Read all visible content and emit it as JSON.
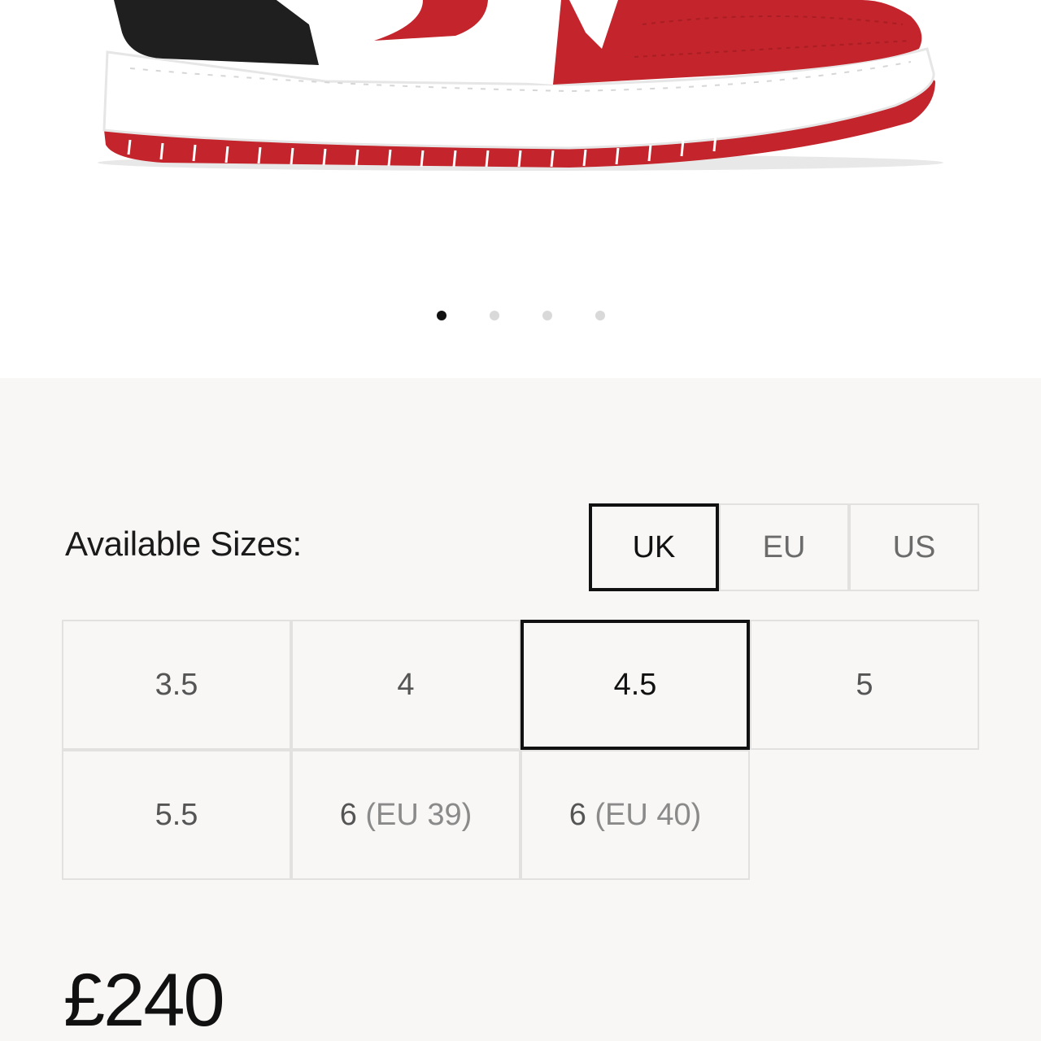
{
  "carousel": {
    "slide_count": 4,
    "active_index": 0
  },
  "sizes": {
    "label": "Available Sizes:",
    "units": [
      {
        "label": "UK",
        "selected": true
      },
      {
        "label": "EU",
        "selected": false
      },
      {
        "label": "US",
        "selected": false
      }
    ],
    "options": [
      {
        "size": "3.5",
        "eu": "",
        "selected": false
      },
      {
        "size": "4",
        "eu": "",
        "selected": false
      },
      {
        "size": "4.5",
        "eu": "",
        "selected": true
      },
      {
        "size": "5",
        "eu": "",
        "selected": false
      },
      {
        "size": "5.5",
        "eu": "",
        "selected": false
      },
      {
        "size": "6",
        "eu": "(EU 39)",
        "selected": false
      },
      {
        "size": "6",
        "eu": "(EU 40)",
        "selected": false
      }
    ]
  },
  "price": "£240",
  "colors": {
    "shoe_red": "#c4242b",
    "shoe_black": "#1f1f1f",
    "selected_border": "#111111",
    "grid_border": "#e2e1df",
    "background": "#f8f7f5"
  }
}
